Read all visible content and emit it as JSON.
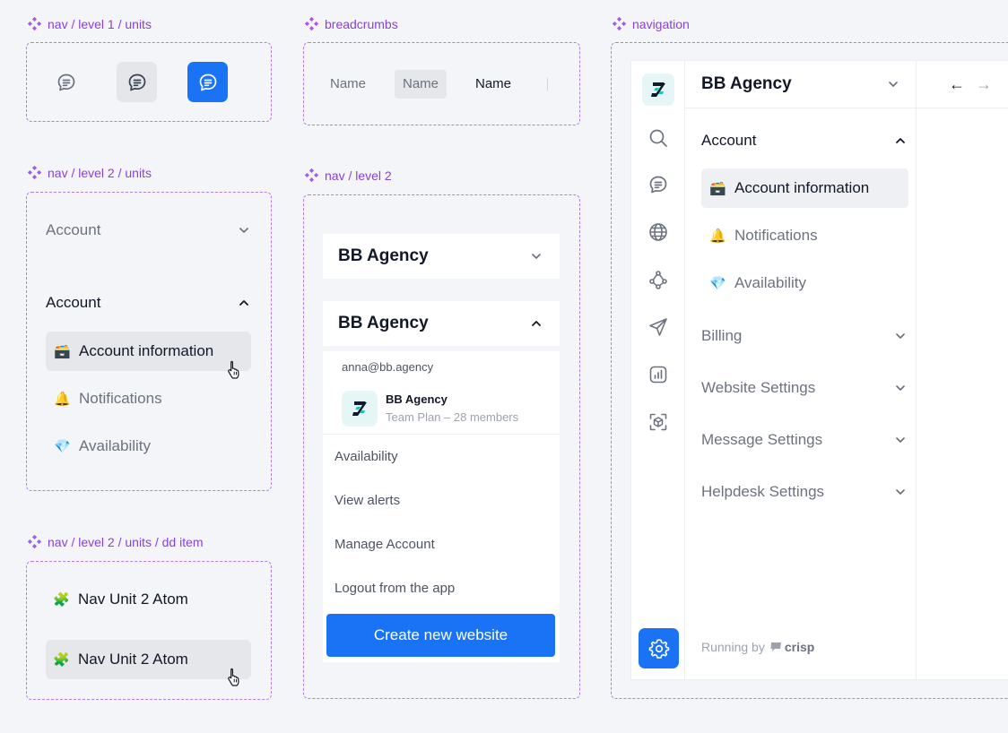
{
  "sections": {
    "level1_units": "nav / level 1 / units",
    "breadcrumbs": "breadcrumbs",
    "navigation": "navigation",
    "level2_units": "nav / level 2 / units",
    "level2": "nav / level 2",
    "dd_item": "nav / level 2 / units / dd item"
  },
  "breadcrumbs": {
    "items": [
      "Name",
      "Name",
      "Name"
    ]
  },
  "level2_units": {
    "collapsed_label": "Account",
    "expanded_label": "Account",
    "items": [
      {
        "emoji": "🗃️",
        "label": "Account information",
        "state": "hover"
      },
      {
        "emoji": "🔔",
        "label": "Notifications"
      },
      {
        "emoji": "💎",
        "label": "Availability"
      }
    ]
  },
  "dropdown": {
    "agency_name": "BB Agency",
    "email": "anna@bb.agency",
    "workspace_name": "BB Agency",
    "workspace_plan": "Team Plan – 28 members",
    "items": [
      "Availability",
      "View alerts",
      "Manage Account",
      "Logout from the app"
    ],
    "create_button": "Create new website"
  },
  "dd_item": {
    "label": "Nav Unit 2 Atom",
    "emoji": "🧩"
  },
  "navigation": {
    "title": "BB Agency",
    "open_section": "Account",
    "sub_items": [
      {
        "emoji": "🗃️",
        "label": "Account information",
        "active": true
      },
      {
        "emoji": "🔔",
        "label": "Notifications"
      },
      {
        "emoji": "💎",
        "label": "Availability"
      }
    ],
    "sections": [
      "Billing",
      "Website Settings",
      "Message Settings",
      "Helpdesk Settings"
    ],
    "footer_prefix": "Running by",
    "footer_brand": "crisp",
    "rail_icons": [
      "search-icon",
      "chat-icon",
      "globe-icon",
      "network-icon",
      "send-icon",
      "analytics-icon",
      "box-icon"
    ],
    "back_arrow": "←",
    "forward_arrow": "→"
  },
  "colors": {
    "accent": "#1a73f5",
    "annotation": "#8b3fe0",
    "logo_bg": "#e6f6f7"
  }
}
